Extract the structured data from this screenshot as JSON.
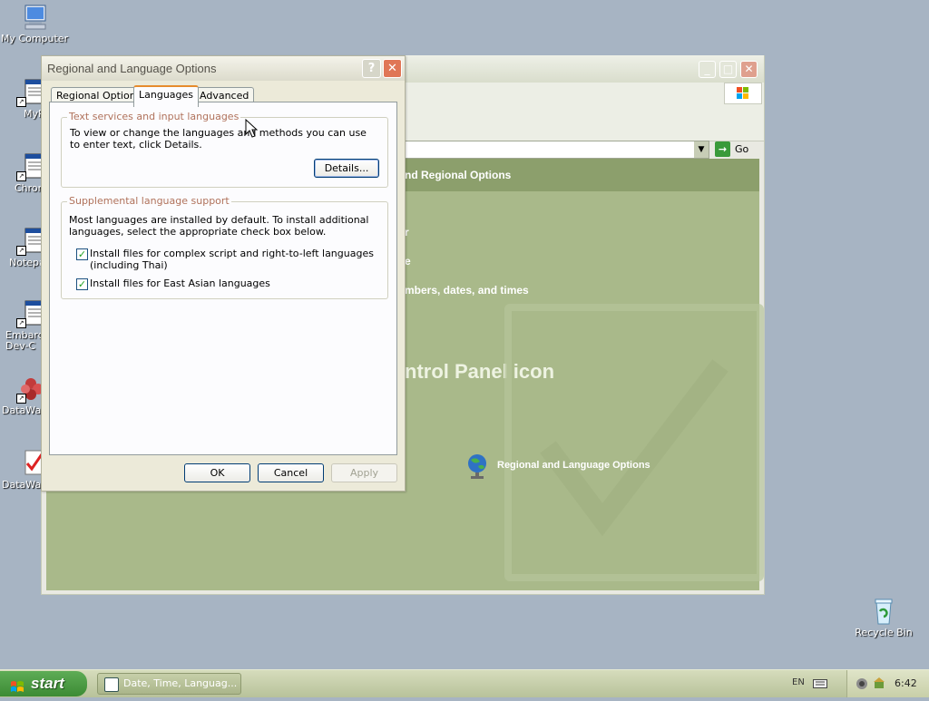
{
  "desktop": {
    "icons": [
      {
        "label": "My Computer"
      },
      {
        "label": "MyPa"
      },
      {
        "label": "Chron"
      },
      {
        "label": "Notepa"
      },
      {
        "label": "Embarca\nDev-C"
      },
      {
        "label": "DataWa"
      },
      {
        "label": "DataWa"
      },
      {
        "label": "Recycle Bin"
      }
    ]
  },
  "control_panel": {
    "address_go": "Go",
    "header_text": "nd Regional Options",
    "task_fragment_1": "r",
    "task_fragment_2": "e",
    "task_numbers": "mbers, dates, and times",
    "icon_heading": "ntrol Panel icon",
    "icon_label": "Regional and Language Options"
  },
  "dialog": {
    "title": "Regional and Language Options",
    "help_glyph": "?",
    "close_glyph": "✕",
    "tabs": [
      {
        "label": "Regional Options",
        "active": false
      },
      {
        "label": "Languages",
        "active": true
      },
      {
        "label": "Advanced",
        "active": false
      }
    ],
    "text_services": {
      "caption": "Text services and input languages",
      "description": "To view or change the languages and methods you can use to enter text, click Details.",
      "details_button": "Details..."
    },
    "supplemental": {
      "caption": "Supplemental language support",
      "description": "Most languages are installed by default. To install additional languages, select the appropriate check box below.",
      "options": [
        {
          "label": "Install files for complex script and right-to-left languages (including Thai)",
          "checked": true
        },
        {
          "label": "Install files for East Asian languages",
          "checked": true
        }
      ]
    },
    "buttons": {
      "ok": "OK",
      "cancel": "Cancel",
      "apply": "Apply"
    }
  },
  "taskbar": {
    "start_label": "start",
    "task_label": "Date, Time, Languag...",
    "language": "EN",
    "clock": "6:42"
  },
  "colors": {
    "desktop": "#a7b4c3",
    "taskbar": "#c3cca4",
    "start_green": "#4a9a42",
    "content_olive": "#a9b98a",
    "tab_accent": "#e68b2c",
    "close_red": "#d9583c"
  }
}
